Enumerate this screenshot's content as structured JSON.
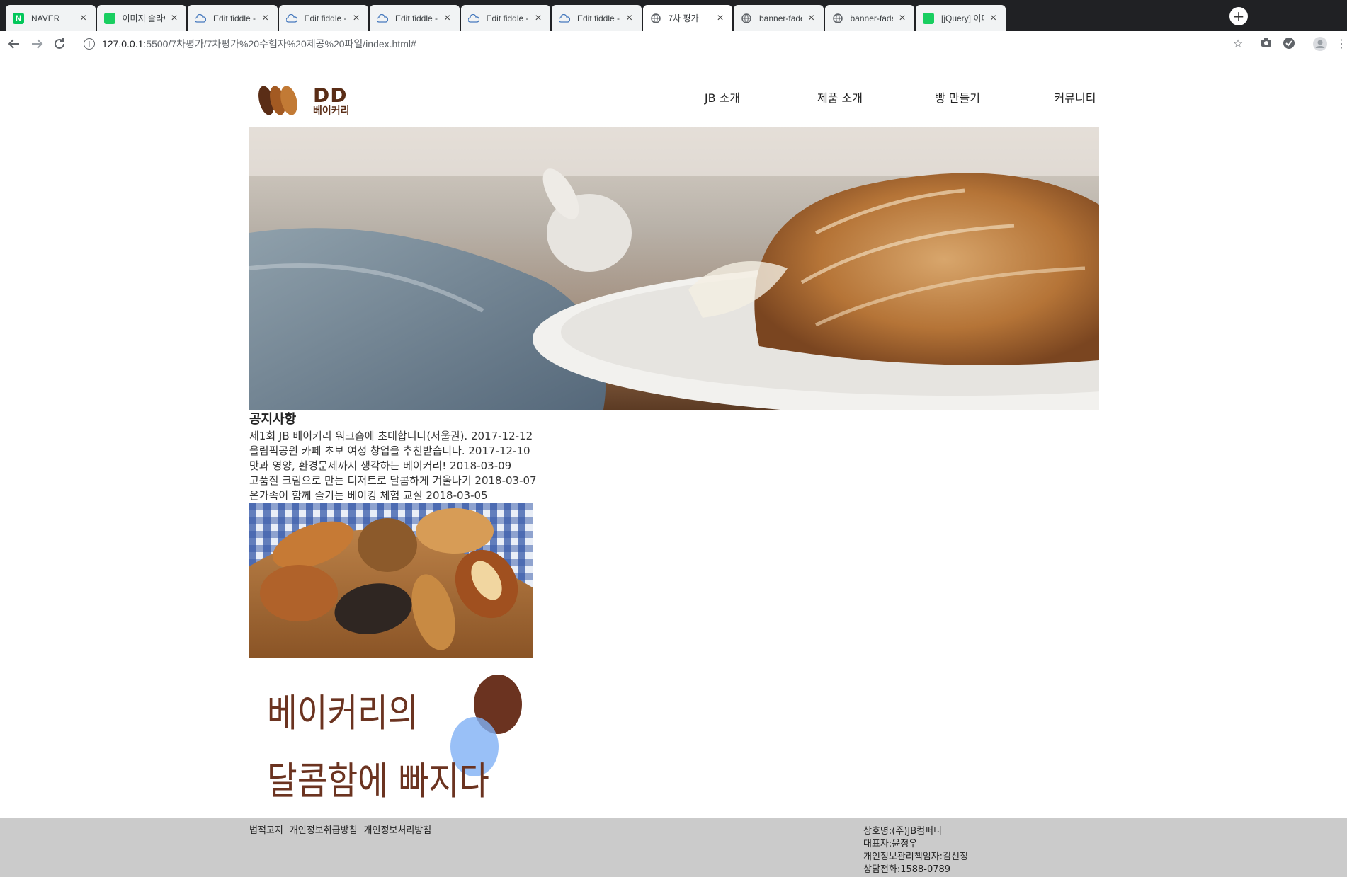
{
  "browser": {
    "tabs": [
      {
        "title": "NAVER",
        "icon": "naver-icon",
        "color": "#03c75a",
        "glyph": "N"
      },
      {
        "title": "이미지 슬라이드",
        "icon": "green-tab-icon",
        "color": "#19ce60",
        "glyph": ""
      },
      {
        "title": "Edit fiddle - JSFiddle",
        "icon": "jsfiddle-icon",
        "color": "#4679bd",
        "glyph": ""
      },
      {
        "title": "Edit fiddle - JSFiddle",
        "icon": "jsfiddle-icon",
        "color": "#4679bd",
        "glyph": ""
      },
      {
        "title": "Edit fiddle - JSFiddle",
        "icon": "jsfiddle-icon",
        "color": "#4679bd",
        "glyph": ""
      },
      {
        "title": "Edit fiddle - JSFiddle",
        "icon": "jsfiddle-icon",
        "color": "#4679bd",
        "glyph": ""
      },
      {
        "title": "Edit fiddle - JSFiddle",
        "icon": "jsfiddle-icon",
        "color": "#4679bd",
        "glyph": ""
      },
      {
        "title": "7차 평가",
        "icon": "globe-icon",
        "color": "#5f6368",
        "glyph": ""
      },
      {
        "title": "banner-fade.html",
        "icon": "globe-icon",
        "color": "#5f6368",
        "glyph": ""
      },
      {
        "title": "banner-fade.html",
        "icon": "globe-icon",
        "color": "#5f6368",
        "glyph": ""
      },
      {
        "title": "[jQuery] 이미지 슬라이드",
        "icon": "green-tab-icon",
        "color": "#19ce60",
        "glyph": ""
      }
    ],
    "active_tab_index": 7,
    "url_host": "127.0.0.1",
    "url_path": ":5500/7차평가/7차평가%20수험자%20제공%20파일/index.html#"
  },
  "site": {
    "logo": {
      "main": "DD",
      "sub": "베이커리"
    },
    "nav": [
      "JB 소개",
      "제품 소개",
      "빵 만들기",
      "커뮤니티"
    ],
    "notice": {
      "title": "공지사항",
      "items": [
        "제1회 JB 베이커리 워크숍에 초대합니다(서울권). 2017-12-12",
        "올림픽공원 카페 초보 여성 창업을 추천받습니다. 2017-12-10",
        "맛과 영양, 환경문제까지 생각하는 베이커리! 2018-03-09",
        "고품질 크림으로 만든 디저트로 달콤하게 겨울나기 2018-03-07",
        "온가족이 함께 즐기는 베이킹 체험 교실 2018-03-05"
      ]
    },
    "banner": {
      "line1": "베이커리의",
      "line2": "달콤함에 빠지다"
    },
    "footer": {
      "links": [
        "법적고지",
        "개인정보취급방침",
        "개인정보처리방침"
      ],
      "info": [
        "상호명:(주)JB컴퍼니",
        "대표자:윤정우",
        "개인정보관리책임자:김선정",
        "상담전화:1588-0789"
      ]
    }
  },
  "colors": {
    "brand_brown": "#5a2d16",
    "banner_text": "#6b3320",
    "footer_bg": "#cbcbcb"
  }
}
